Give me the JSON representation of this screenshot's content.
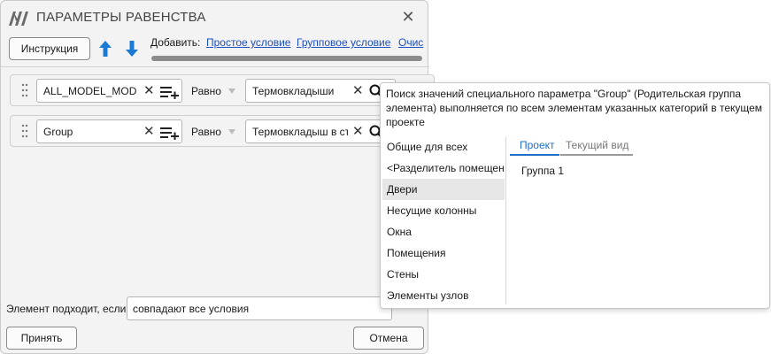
{
  "window": {
    "title": "ПАРАМЕТРЫ РАВЕНСТВА",
    "close_glyph": "✕"
  },
  "toolbar": {
    "instruction_label": "Инструкция",
    "add_label": "Добавить:",
    "links": [
      "Простое условие",
      "Групповое условие",
      "Очис"
    ]
  },
  "conditions": [
    {
      "parameter": "ALL_MODEL_MODEL",
      "operator": "Равно",
      "value": "Термовкладыши"
    },
    {
      "parameter": "Group",
      "operator": "Равно",
      "value": "Термовкладыш в ст"
    }
  ],
  "footer": {
    "match_label": "Элемент подходит, если",
    "match_value": "совпадают все условия",
    "accept_label": "Принять",
    "cancel_label": "Отмена"
  },
  "popup": {
    "description": "Поиск значений специального параметра \"Group\" (Родительская группа элемента) выполняется по всем элементам указанных категорий в текущем проекте",
    "categories": [
      "Общие для всех",
      "<Разделитель помещений>",
      "Двери",
      "Несущие колонны",
      "Окна",
      "Помещения",
      "Стены",
      "Элементы узлов"
    ],
    "selected_category_index": 2,
    "tabs": [
      "Проект",
      "Текущий вид"
    ],
    "active_tab_index": 0,
    "values": [
      "Группа 1"
    ]
  },
  "colors": {
    "accent": "#1f6fc7",
    "link": "#1f4fbf",
    "arrow": "#1a7ad4"
  }
}
